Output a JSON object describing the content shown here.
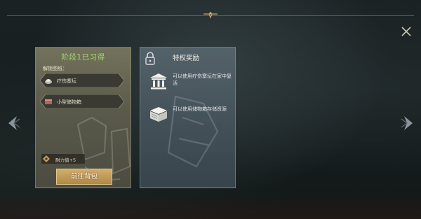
{
  "stage_card": {
    "title": "阶段1已习得",
    "unlock_label": "解锁图纸：",
    "items": [
      {
        "label": "疗伤寨坛",
        "icon": "altar-icon"
      },
      {
        "label": "小型储物箱",
        "icon": "storage-box-icon"
      }
    ],
    "stat": {
      "label": "耐力值+5",
      "icon": "stamina-icon"
    },
    "goto_button": "前往背包"
  },
  "privilege_card": {
    "title": "特权奖励",
    "perks": [
      {
        "text": "可以使用疗伤寨坛在家中复活",
        "icon": "temple-icon"
      },
      {
        "text": "可以使用储物箱存储资源",
        "icon": "chest-icon"
      }
    ]
  },
  "colors": {
    "stage_title": "#9fd86a",
    "button_gold": "#c9a25e",
    "frame_gold": "#aa8c50"
  }
}
